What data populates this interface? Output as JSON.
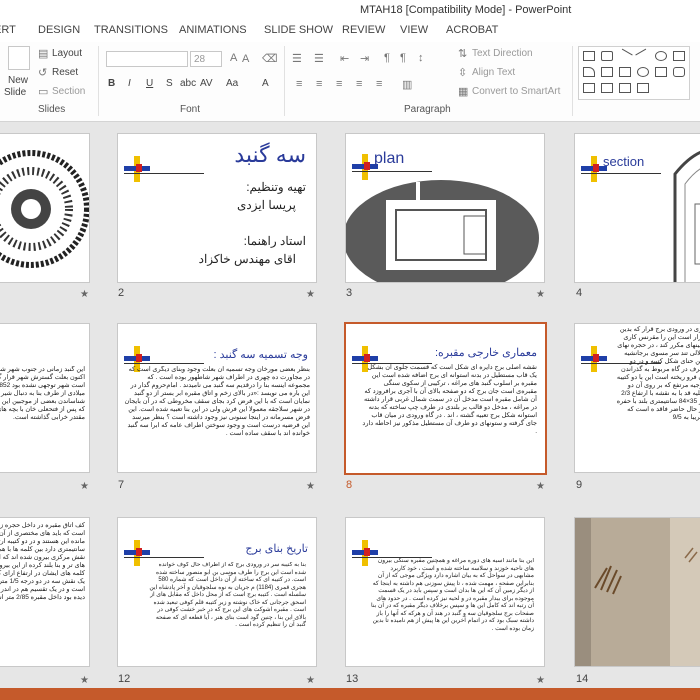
{
  "window": {
    "title": "MTAH18 [Compatibility Mode] - PowerPoint"
  },
  "ribbon_tabs": [
    "ERT",
    "DESIGN",
    "TRANSITIONS",
    "ANIMATIONS",
    "SLIDE SHOW",
    "REVIEW",
    "VIEW",
    "ACROBAT"
  ],
  "ribbon": {
    "slides_group": {
      "label": "Slides",
      "new_slide": "New",
      "new_slide_2": "Slide",
      "layout": "Layout",
      "reset": "Reset",
      "section": "Section"
    },
    "font_group": {
      "label": "Font",
      "font_size": "28",
      "bold": "B",
      "italic": "I",
      "underline": "U",
      "strike": "S",
      "shadow": "abc",
      "spacing": "AV",
      "case": "Aa",
      "color": "A"
    },
    "paragraph_group": {
      "label": "Paragraph",
      "text_direction": "Text Direction",
      "align_text": "Align Text",
      "smartart": "Convert to SmartArt"
    }
  },
  "slides": [
    {
      "number": "",
      "title": ""
    },
    {
      "number": "2",
      "title": "سه گنبد",
      "lines": [
        "تهیه وتنظیم:",
        "پریسا ایزدی",
        "استاد راهنما:",
        "اقای مهندس خاکزاد"
      ]
    },
    {
      "number": "3",
      "title": "plan"
    },
    {
      "number": "4",
      "title": "section"
    },
    {
      "number": "",
      "title": "",
      "body": "این گنبد زمانی در جنوب شهر شده که اکنون بعلت گسترش شهر قرار گرفته است شهر توجهی نشده بود 1852 میلادی از طرف بنا به دنبال شیر شناساندن بعضی از موجبین این بوده که پس از فتحعلی خان با بچه های مقتدر خرابی گذاشته است."
    },
    {
      "number": "7",
      "title": "وجه تسمیه سه گنبد :",
      "body": "بنظر بعضی مورخان وجه تسمیه آن بعلت وجود وبنای دیگری است که در مجاورت ده چهری در اطراف شهر شاطهور بوده است . که مجموعه اینسه بنا را درقدیم سه گنبد می نامیدند . امام‌حروم گدار در این باره می نویسد :«در بالای زخم و اتاق مقبره ابر بستر از دو گنبد نمایان است که با این فرض کرد بجای سقف مخروطی که در آن بایجان در شهر سلاجقه معمولا این فرش ولی در این بنا تعبیه شده است. این فرض مسرمانه در اینجا سنونی نیز وجود داشته است ؟ بنظر میرسد این فرضیه درست است و وجود سوختن اطراف عامه که ابرا سه گنبد خوانده اند با سقف ساده است ."
    },
    {
      "number": "8",
      "title": "معماری خارجی مقبره:",
      "body": "نقشه اصلی برج دایره ای شکل است که قسمت جلوی آن بشکل یک قاب مستطیل در بدنه استوانه ای برج اضافه شده است این مقبره بر اسلوب گنبد های مراغه ، ترکیبی از سکوی سنگی مقبره‌ی است جان برج که دو صفحه بالای آن با آجری برافروزد که آن شامل مقبره است مدخل آن در سمت شمال غربی قرار داشته در مراغه ، مدخل دو قالب بر بلندی در طرف چپ ساخته که بدنه استوانه شکل برج تعبیه گشته ، اند . در گاه ورودی در میان قاب جای گرفته و ستونهای دو طرف آن مستطیل مذکور نیز احاطه دارد ."
    },
    {
      "number": "9",
      "title": "",
      "body": "دری در ورودی برج قرار که بدین قرار است این را مقرنس کاری مبینهای مکرر کند ، در حجره نهای خلالی تند سر مسوی برجانشیه پهن حنای شکل کتیبه و در دو طرف در گاه مربوط به گذراندن آن فرو ریخته است این با دو کتیبه برجیه مرتفع که بر روی آن دو ریلیه قد با به نقشه با ارتفاع 2/3 در 35×84 سانتیمتری بلند با حفره در حال حاضر فاقد ه است که تقریبا به 9/5"
    },
    {
      "number": "",
      "title": "",
      "body": "کف اتاق مقبره در داخل حجره زیر زمینی است که باید های مختصری از آن باقی مانده این هستند و در دو کتیبه ارتفاع 25 سانتیمتری دارد بین کلمه ها با همه دو نقش مرکزی بیرون شده اند که ای اینکه های تر و بنا بلند کرده از این بیرون شد کلمه های ایشان در ارتفاع ارای کلمه ها با یک نقش سه در دو درجه 1/5 متر است است و در یک تقسیم هم در اندر ها نیز دیده بود داخل مقبره 2/85 متر است ."
    },
    {
      "number": "12",
      "title": "تاریخ بنای برج",
      "body": "بنا به کتیبه سر در ورودی برج که از اطراف حال کوف خوانده شده است این برج را طرف موسی بن ابو منصور ساخته شده است. در کتیبه ای که ساخته از آن داخل است که شماره 580 هجری قمری (1184) م جریان به نوه سلجوقیان و آخر پادشاه این سلسله است . کتیبه برج است که از محل داخل که مقابل های از اسحق جرجانی که خاک نوشته و زیر کتیبه قلم کوفی تبعید شده است . مقبره اشوکت های این برج که در خبر خشت کوفی در بالای این بنا ، چنین گود است بنای هنر ، آیا قطعه ای که صفحه گنبد آن را تنظیم کرده است ."
    },
    {
      "number": "13",
      "title": "",
      "body": "این بنا مانند اسیه های دوره مراغه و همچنین مقبره سنگی بیرون های ناحیه خوزند و سلاسه ساخته شده و است ، خود کاربرد مشابهی در سواحل که به بیان اشاره دارد ویژگی موجی که از آن بنابراین صفحه ، مهمت شده ، تا پیش سوزنی هم داشته به اینجا که از دیگر زمین آن که این ها بدان است و سپس باید در یک قسمت موجوده برای بیدار مقبره در و لحیه نیز کرده است . در حدود های آن رتبه اند که کامل این ها و سپس برخلاف دیگر مقبره که در آن بنا صفحات برج سلجوقیان سه و گنبد در هند آن و هرکه که آنها را باز داشته سبک بود که در اتمام آخرین این ها پیش از هم نامیده تا بدین زمان بوده است . "
    },
    {
      "number": "14",
      "title": ""
    }
  ],
  "colors": {
    "accent": "#c55a2b",
    "title_blue": "#2a3b9a",
    "selection": "#c55a2b"
  }
}
